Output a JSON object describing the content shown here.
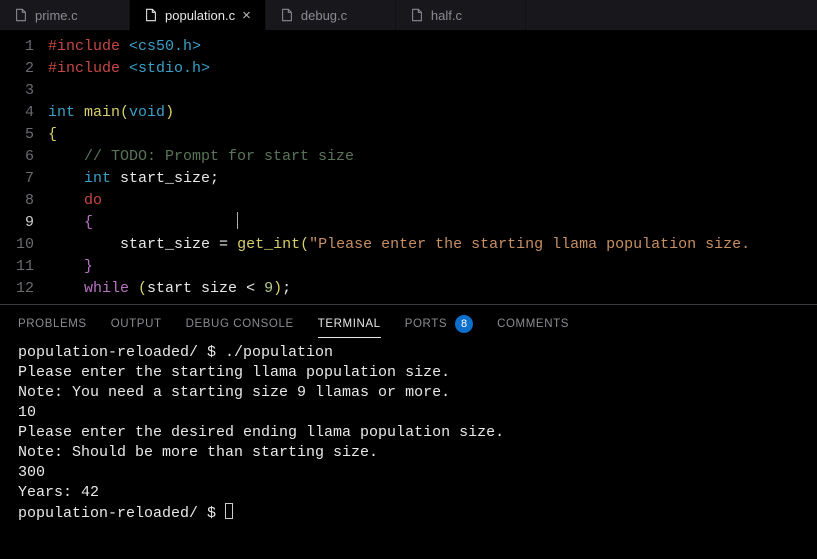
{
  "tabs": [
    {
      "label": "prime.c",
      "active": false,
      "close": false
    },
    {
      "label": "population.c",
      "active": true,
      "close": true
    },
    {
      "label": "debug.c",
      "active": false,
      "close": false
    },
    {
      "label": "half.c",
      "active": false,
      "close": false
    }
  ],
  "editor": {
    "lines": [
      {
        "n": 1,
        "tokens": [
          [
            "#include ",
            "pp"
          ],
          [
            "<cs50.h>",
            "inc"
          ]
        ]
      },
      {
        "n": 2,
        "tokens": [
          [
            "#include ",
            "pp"
          ],
          [
            "<stdio.h>",
            "inc"
          ]
        ]
      },
      {
        "n": 3,
        "tokens": []
      },
      {
        "n": 4,
        "tokens": [
          [
            "int ",
            "type"
          ],
          [
            "main",
            "fn"
          ],
          [
            "(",
            "br"
          ],
          [
            "void",
            "type"
          ],
          [
            ")",
            "br"
          ]
        ]
      },
      {
        "n": 5,
        "tokens": [
          [
            "{",
            "br"
          ]
        ]
      },
      {
        "n": 6,
        "tokens": [
          [
            "    ",
            "id"
          ],
          [
            "// TODO: Prompt for start size",
            "cmt"
          ]
        ]
      },
      {
        "n": 7,
        "tokens": [
          [
            "    ",
            "id"
          ],
          [
            "int ",
            "type"
          ],
          [
            "start_size",
            "id"
          ],
          [
            ";",
            "op"
          ]
        ]
      },
      {
        "n": 8,
        "tokens": [
          [
            "    ",
            "id"
          ],
          [
            "do",
            "kw"
          ]
        ]
      },
      {
        "n": 9,
        "cursor": true,
        "cursor_col": 21,
        "tokens": [
          [
            "    ",
            "id"
          ],
          [
            "{",
            "br2"
          ]
        ]
      },
      {
        "n": 10,
        "tokens": [
          [
            "        start_size ",
            "id"
          ],
          [
            "=",
            "op"
          ],
          [
            " ",
            "id"
          ],
          [
            "get_int",
            "fn"
          ],
          [
            "(",
            "br"
          ],
          [
            "\"Please enter the starting llama population size.",
            "str"
          ]
        ]
      },
      {
        "n": 11,
        "tokens": [
          [
            "    ",
            "id"
          ],
          [
            "}",
            "br2"
          ]
        ]
      },
      {
        "n": 12,
        "tokens": [
          [
            "    ",
            "id"
          ],
          [
            "while ",
            "kw2"
          ],
          [
            "(",
            "br"
          ],
          [
            "start size ",
            "id"
          ],
          [
            "<",
            "op"
          ],
          [
            " ",
            "id"
          ],
          [
            "9",
            "num"
          ],
          [
            ")",
            "br"
          ],
          [
            ";",
            "op"
          ]
        ]
      }
    ]
  },
  "panel": {
    "tabs": {
      "problems": "PROBLEMS",
      "output": "OUTPUT",
      "debug_console": "DEBUG CONSOLE",
      "terminal": "TERMINAL",
      "ports": "PORTS",
      "ports_badge": "8",
      "comments": "COMMENTS"
    },
    "active": "terminal"
  },
  "terminal": {
    "lines": [
      "population-reloaded/ $ ./population",
      "Please enter the starting llama population size.",
      "Note: You need a starting size 9 llamas or more.",
      "10",
      "Please enter the desired ending llama population size.",
      "Note: Should be more than starting size.",
      "300",
      "Years: 42",
      "population-reloaded/ $ "
    ]
  }
}
